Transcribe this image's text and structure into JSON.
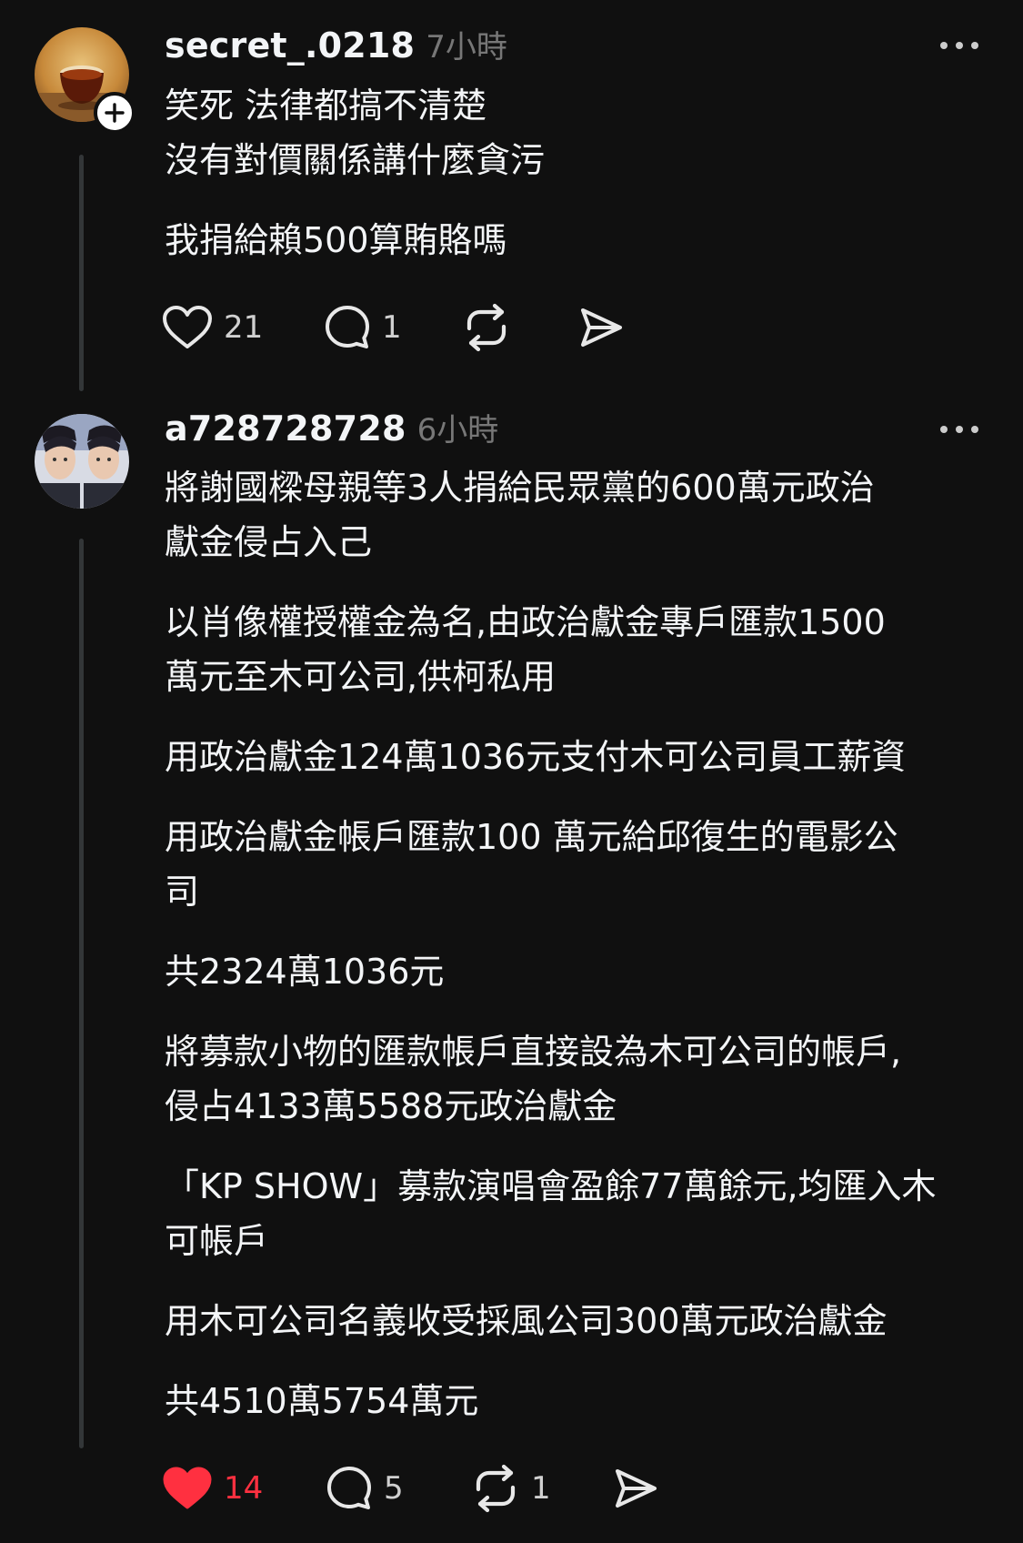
{
  "colors": {
    "background": "#101010",
    "text": "#f3f5f7",
    "muted": "#777777",
    "like_active": "#ff3040"
  },
  "posts": [
    {
      "username": "secret_.0218",
      "timestamp": "7小時",
      "paragraphs": [
        "笑死 法律都搞不清楚\n沒有對價關係講什麼貪污",
        "我捐給賴500算賄賂嗎"
      ],
      "likes": "21",
      "replies": "1",
      "reposts": "",
      "liked": false,
      "avatar_icon": "tea-cup-avatar",
      "has_follow_button": true
    },
    {
      "username": "a728728728",
      "timestamp": "6小時",
      "paragraphs": [
        "將謝國樑母親等3人捐給民眾黨的600萬元政治\n獻金侵占入己",
        "以肖像權授權金為名,由政治獻金專戶匯款1500\n萬元至木可公司,供柯私用",
        "用政治獻金124萬1036元支付木可公司員工薪資",
        "用政治獻金帳戶匯款100 萬元給邱復生的電影公\n司",
        "共2324萬1036元",
        "將募款小物的匯款帳戶直接設為木可公司的帳戶,\n侵占4133萬5588元政治獻金",
        "「KP SHOW」募款演唱會盈餘77萬餘元,均匯入木\n可帳戶",
        "用木可公司名義收受採風公司300萬元政治獻金",
        "共4510萬5754萬元"
      ],
      "likes": "14",
      "replies": "5",
      "reposts": "1",
      "liked": true,
      "avatar_icon": "mirrored-portrait-avatar",
      "has_follow_button": false
    }
  ]
}
